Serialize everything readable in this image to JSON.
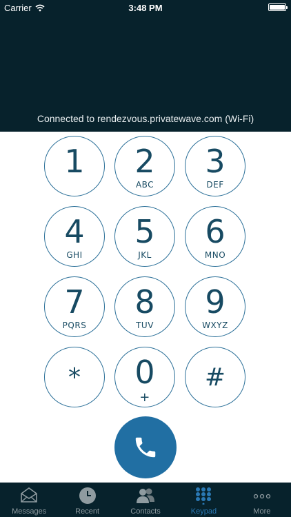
{
  "status": {
    "carrier": "Carrier",
    "time": "3:48 PM"
  },
  "connection": "Connected to rendezvous.privatewave.com (Wi-Fi)",
  "keypad": [
    {
      "digit": "1",
      "letters": ""
    },
    {
      "digit": "2",
      "letters": "ABC"
    },
    {
      "digit": "3",
      "letters": "DEF"
    },
    {
      "digit": "4",
      "letters": "GHI"
    },
    {
      "digit": "5",
      "letters": "JKL"
    },
    {
      "digit": "6",
      "letters": "MNO"
    },
    {
      "digit": "7",
      "letters": "PQRS"
    },
    {
      "digit": "8",
      "letters": "TUV"
    },
    {
      "digit": "9",
      "letters": "WXYZ"
    },
    {
      "digit": "*",
      "letters": ""
    },
    {
      "digit": "0",
      "letters": "+"
    },
    {
      "digit": "#",
      "letters": ""
    }
  ],
  "call_button": {
    "icon": "phone-icon"
  },
  "tabs": [
    {
      "label": "Messages",
      "icon": "envelope-icon"
    },
    {
      "label": "Recent",
      "icon": "clock-icon"
    },
    {
      "label": "Contacts",
      "icon": "people-icon"
    },
    {
      "label": "Keypad",
      "icon": "keypad-grid-icon"
    },
    {
      "label": "More",
      "icon": "more-icon"
    }
  ],
  "colors": {
    "header_bg": "#07222c",
    "accent": "#216fa3",
    "key_text": "#174a62",
    "tab_inactive": "#8f9ba0",
    "tab_active": "#2a78b3"
  }
}
